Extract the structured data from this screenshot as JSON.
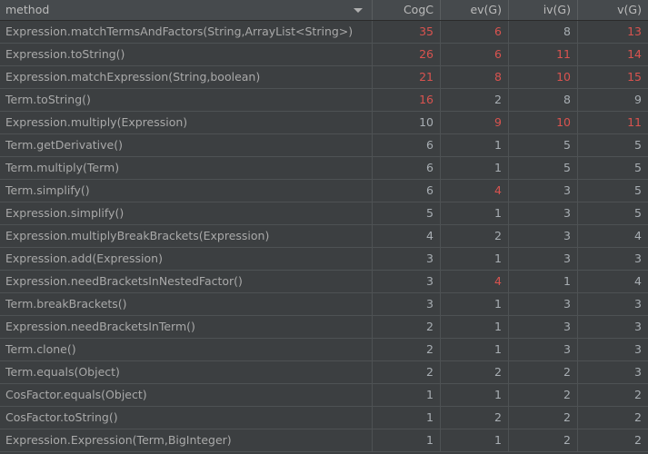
{
  "table": {
    "columns": [
      {
        "key": "method",
        "label": "method",
        "align": "left"
      },
      {
        "key": "cogc",
        "label": "CogC",
        "align": "right"
      },
      {
        "key": "evg",
        "label": "ev(G)",
        "align": "right"
      },
      {
        "key": "ivg",
        "label": "iv(G)",
        "align": "right"
      },
      {
        "key": "vg",
        "label": "v(G)",
        "align": "right"
      }
    ],
    "sort": {
      "column": "CogC",
      "direction": "descending",
      "icon": "triangle-down-icon"
    },
    "colors": {
      "header_background": "#464a4d",
      "row_background": "#3c3f41",
      "grid_line": "#4e5254",
      "text": "#a9a9a9",
      "value_normal": "#a8aeb3",
      "value_highlight": "#d9534f"
    },
    "rows": [
      {
        "method": "Expression.matchTermsAndFactors(String,ArrayList<String>)",
        "cogc": "35",
        "cogc_hot": true,
        "evg": "6",
        "evg_hot": true,
        "ivg": "8",
        "ivg_hot": false,
        "vg": "13",
        "vg_hot": true
      },
      {
        "method": "Expression.toString()",
        "cogc": "26",
        "cogc_hot": true,
        "evg": "6",
        "evg_hot": true,
        "ivg": "11",
        "ivg_hot": true,
        "vg": "14",
        "vg_hot": true
      },
      {
        "method": "Expression.matchExpression(String,boolean)",
        "cogc": "21",
        "cogc_hot": true,
        "evg": "8",
        "evg_hot": true,
        "ivg": "10",
        "ivg_hot": true,
        "vg": "15",
        "vg_hot": true
      },
      {
        "method": "Term.toString()",
        "cogc": "16",
        "cogc_hot": true,
        "evg": "2",
        "evg_hot": false,
        "ivg": "8",
        "ivg_hot": false,
        "vg": "9",
        "vg_hot": false
      },
      {
        "method": "Expression.multiply(Expression)",
        "cogc": "10",
        "cogc_hot": false,
        "evg": "9",
        "evg_hot": true,
        "ivg": "10",
        "ivg_hot": true,
        "vg": "11",
        "vg_hot": true
      },
      {
        "method": "Term.getDerivative()",
        "cogc": "6",
        "cogc_hot": false,
        "evg": "1",
        "evg_hot": false,
        "ivg": "5",
        "ivg_hot": false,
        "vg": "5",
        "vg_hot": false
      },
      {
        "method": "Term.multiply(Term)",
        "cogc": "6",
        "cogc_hot": false,
        "evg": "1",
        "evg_hot": false,
        "ivg": "5",
        "ivg_hot": false,
        "vg": "5",
        "vg_hot": false
      },
      {
        "method": "Term.simplify()",
        "cogc": "6",
        "cogc_hot": false,
        "evg": "4",
        "evg_hot": true,
        "ivg": "3",
        "ivg_hot": false,
        "vg": "5",
        "vg_hot": false
      },
      {
        "method": "Expression.simplify()",
        "cogc": "5",
        "cogc_hot": false,
        "evg": "1",
        "evg_hot": false,
        "ivg": "3",
        "ivg_hot": false,
        "vg": "5",
        "vg_hot": false
      },
      {
        "method": "Expression.multiplyBreakBrackets(Expression)",
        "cogc": "4",
        "cogc_hot": false,
        "evg": "2",
        "evg_hot": false,
        "ivg": "3",
        "ivg_hot": false,
        "vg": "4",
        "vg_hot": false
      },
      {
        "method": "Expression.add(Expression)",
        "cogc": "3",
        "cogc_hot": false,
        "evg": "1",
        "evg_hot": false,
        "ivg": "3",
        "ivg_hot": false,
        "vg": "3",
        "vg_hot": false
      },
      {
        "method": "Expression.needBracketsInNestedFactor()",
        "cogc": "3",
        "cogc_hot": false,
        "evg": "4",
        "evg_hot": true,
        "ivg": "1",
        "ivg_hot": false,
        "vg": "4",
        "vg_hot": false
      },
      {
        "method": "Term.breakBrackets()",
        "cogc": "3",
        "cogc_hot": false,
        "evg": "1",
        "evg_hot": false,
        "ivg": "3",
        "ivg_hot": false,
        "vg": "3",
        "vg_hot": false
      },
      {
        "method": "Expression.needBracketsInTerm()",
        "cogc": "2",
        "cogc_hot": false,
        "evg": "1",
        "evg_hot": false,
        "ivg": "3",
        "ivg_hot": false,
        "vg": "3",
        "vg_hot": false
      },
      {
        "method": "Term.clone()",
        "cogc": "2",
        "cogc_hot": false,
        "evg": "1",
        "evg_hot": false,
        "ivg": "3",
        "ivg_hot": false,
        "vg": "3",
        "vg_hot": false
      },
      {
        "method": "Term.equals(Object)",
        "cogc": "2",
        "cogc_hot": false,
        "evg": "2",
        "evg_hot": false,
        "ivg": "2",
        "ivg_hot": false,
        "vg": "3",
        "vg_hot": false
      },
      {
        "method": "CosFactor.equals(Object)",
        "cogc": "1",
        "cogc_hot": false,
        "evg": "1",
        "evg_hot": false,
        "ivg": "2",
        "ivg_hot": false,
        "vg": "2",
        "vg_hot": false
      },
      {
        "method": "CosFactor.toString()",
        "cogc": "1",
        "cogc_hot": false,
        "evg": "2",
        "evg_hot": false,
        "ivg": "2",
        "ivg_hot": false,
        "vg": "2",
        "vg_hot": false
      },
      {
        "method": "Expression.Expression(Term,BigInteger)",
        "cogc": "1",
        "cogc_hot": false,
        "evg": "1",
        "evg_hot": false,
        "ivg": "2",
        "ivg_hot": false,
        "vg": "2",
        "vg_hot": false
      }
    ]
  }
}
